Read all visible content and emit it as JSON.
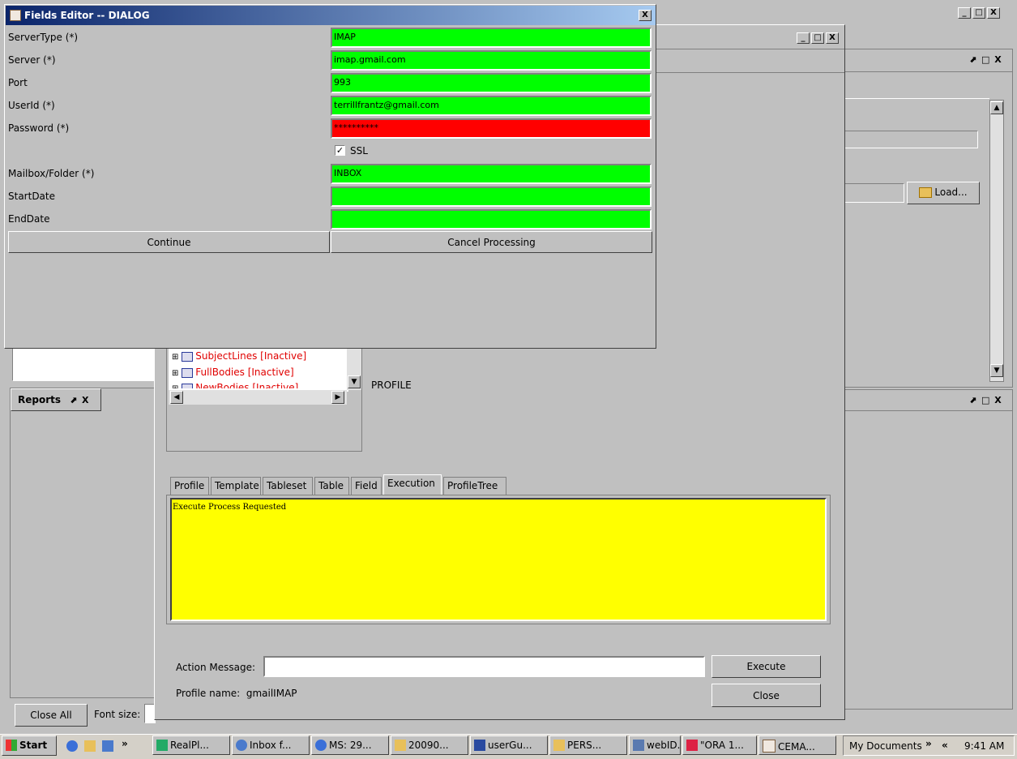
{
  "main_window": {
    "controls": [
      "_",
      "□",
      "X"
    ]
  },
  "inner_window": {
    "controls": [
      "_",
      "□",
      "X"
    ]
  },
  "panel_controls": "⬈ □ X",
  "load_button": "Load...",
  "reports_panel": {
    "title": "Reports",
    "controls": "⬈ X"
  },
  "bottom_bar": {
    "close_all": "Close All",
    "font_size_label": "Font size:"
  },
  "tree": {
    "items": [
      "SubjectLines [Inactive]",
      "FullBodies [Inactive]",
      "NewBodies [Inactive]"
    ],
    "profile_label": "PROFILE"
  },
  "tabs": [
    "Profile",
    "Template",
    "Tableset",
    "Table",
    "Field",
    "Execution",
    "ProfileTree"
  ],
  "active_tab": "Execution",
  "execution_log": "Execute Process Requested",
  "action_message": {
    "label": "Action Message:",
    "value": ""
  },
  "execute_button": "Execute",
  "close_button": "Close",
  "profile_name": {
    "label": "Profile name:",
    "value": "gmailIMAP"
  },
  "dialog": {
    "title": "Fields Editor -- DIALOG",
    "close": "X",
    "fields": [
      {
        "label": "ServerType (*)",
        "value": "IMAP",
        "state": "valid"
      },
      {
        "label": "Server (*)",
        "value": "imap.gmail.com",
        "state": "valid"
      },
      {
        "label": "Port",
        "value": "993",
        "state": "valid"
      },
      {
        "label": "UserId (*)",
        "value": "terrillfrantz@gmail.com",
        "state": "valid"
      },
      {
        "label": "Password (*)",
        "value": "**********",
        "state": "invalid"
      }
    ],
    "ssl": {
      "label": "SSL",
      "checked": true
    },
    "fields2": [
      {
        "label": "Mailbox/Folder (*)",
        "value": "INBOX",
        "state": "valid"
      },
      {
        "label": "StartDate",
        "value": "",
        "state": "valid"
      },
      {
        "label": "EndDate",
        "value": "",
        "state": "valid"
      }
    ],
    "continue_button": "Continue",
    "cancel_button": "Cancel Processing"
  },
  "colors": {
    "valid": "#00ff00",
    "invalid": "#ff0000",
    "log_bg": "#ffff00",
    "titlebar": "#0a246a"
  },
  "taskbar": {
    "start": "Start",
    "more": "»",
    "items": [
      "RealPl...",
      "Inbox f...",
      "MS: 29...",
      "20090...",
      "userGu...",
      "PERS...",
      "webID...",
      "\"ORA 1...",
      "CEMA..."
    ],
    "tray_label": "My Documents",
    "tray_more": "»",
    "tray_arrows": "«",
    "clock": "9:41 AM"
  }
}
